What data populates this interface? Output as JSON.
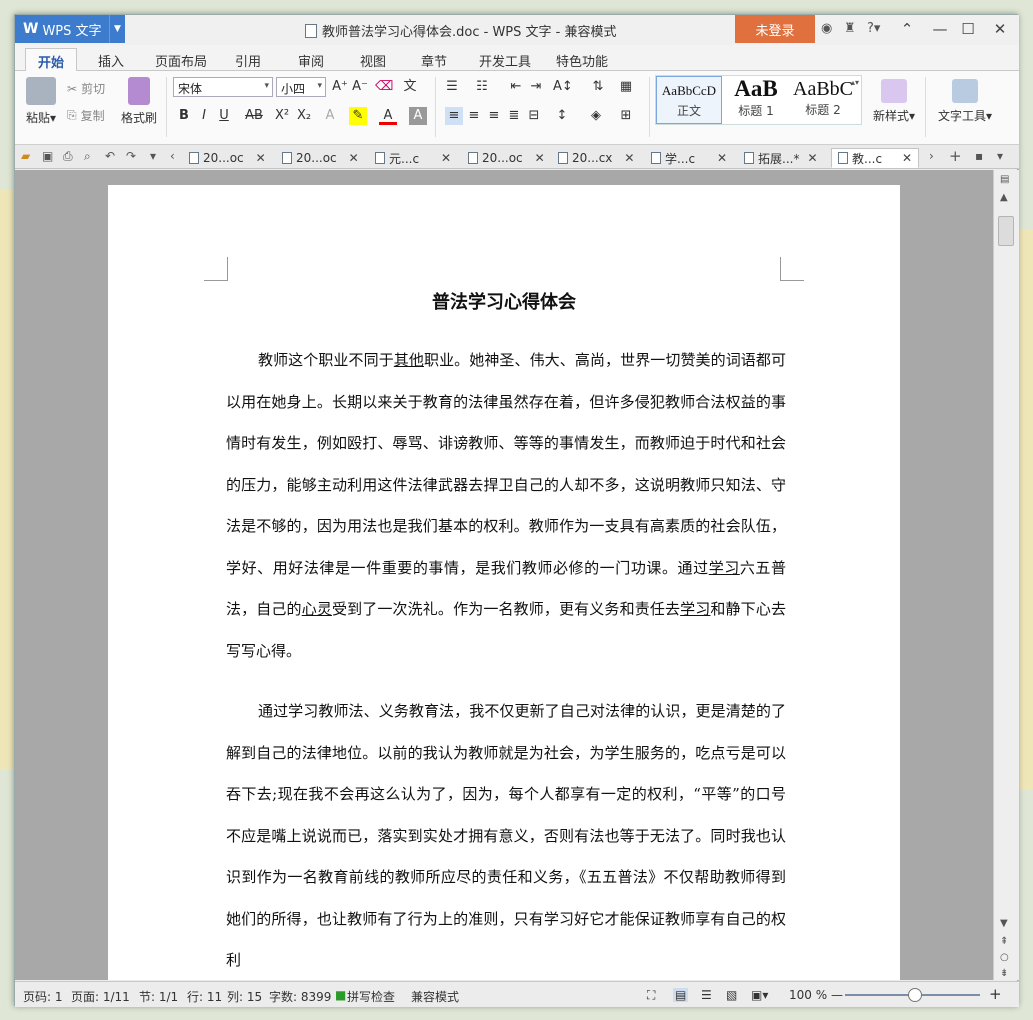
{
  "titlebar": {
    "app_label": "WPS 文字",
    "document_title": "教师普法学习心得体会.doc - WPS 文字 - 兼容模式",
    "login_label": "未登录",
    "help_label": "?"
  },
  "menu": {
    "tabs": [
      "开始",
      "插入",
      "页面布局",
      "引用",
      "审阅",
      "视图",
      "章节",
      "开发工具",
      "特色功能"
    ],
    "active": "开始"
  },
  "ribbon": {
    "paste": "粘贴",
    "cut": "剪切",
    "copy": "复制",
    "format_painter": "格式刷",
    "font_name": "宋体",
    "font_size": "小四",
    "styles": [
      {
        "preview": "AaBbCcD",
        "label": "正文"
      },
      {
        "preview": "AaB",
        "label": "标题 1"
      },
      {
        "preview": "AaBbC",
        "label": "标题 2"
      }
    ],
    "new_style": "新样式",
    "text_tools": "文字工具"
  },
  "doc_tabs": [
    "20...oc",
    "20...oc",
    "元...c",
    "20...oc",
    "20...cx",
    "学...c",
    "拓展...*",
    "教...c"
  ],
  "document": {
    "heading": "普法学习心得体会",
    "para1_a": "教师这个职业不同于",
    "para1_u1": "其他",
    "para1_b": "职业。她神圣、伟大、高尚，世界一切赞美的词语都可以用在她身上。长期以来关于教育的法律虽然存在着，但许多侵犯教师合法权益的事情时有发生，例如殴打、辱骂、诽谤教师、等等的事情发生，而教师迫于时代和社会的压力，能够主动利用这件法律武器去捍卫自己的人却不多，这说明教师只知法、守法是不够的，因为用法也是我们基本的权利。教师作为一支具有高素质的社会队伍，学好、用好法律是一件重要的事情，是我们教师必修的一门功课。通过",
    "para1_u2": "学习",
    "para1_c": "六五普法，自己的",
    "para1_u3": "心灵",
    "para1_d": "受到了一次洗礼。作为一名教师，更有义务和责任去",
    "para1_u4": "学习",
    "para1_e": "和静下心去写写心得。",
    "para2": "通过学习教师法、义务教育法，我不仅更新了自己对法律的认识，更是清楚的了解到自己的法律地位。以前的我认为教师就是为社会，为学生服务的，吃点亏是可以吞下去;现在我不会再这么认为了，因为，每个人都享有一定的权利，“平等”的口号不应是嘴上说说而已，落实到实处才拥有意义，否则有法也等于无法了。同时我也认识到作为一名教育前线的教师所应尽的责任和义务，《五五普法》不仅帮助教师得到她们的所得，也让教师有了行为上的准则，只有学习好它才能保证教师享有自己的权利"
  },
  "status": {
    "page_code": "页码: 1",
    "pages": "页面: 1/11",
    "section": "节: 1/1",
    "row": "行: 11",
    "col": "列: 15",
    "word_count": "字数: 8399",
    "spellcheck": "拼写检查",
    "compat": "兼容模式",
    "zoom": "100 %"
  },
  "colors": {
    "app_blue": "#3d7ccc",
    "login_orange": "#e0703d",
    "active_tab_text": "#2a5caa"
  }
}
